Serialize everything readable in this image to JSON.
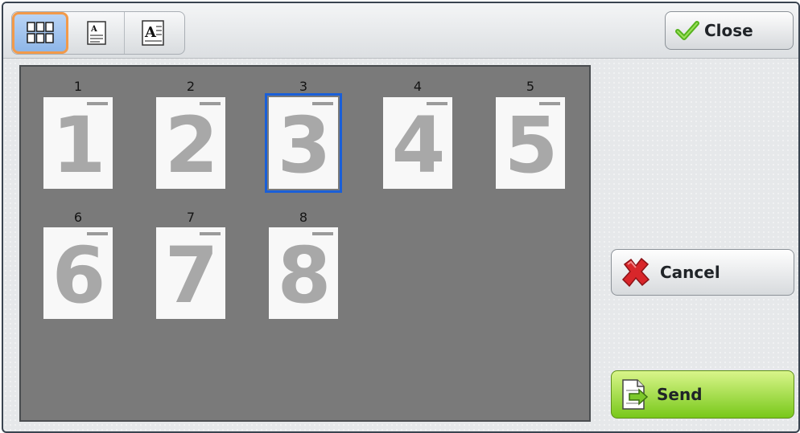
{
  "toolbar": {
    "views": [
      {
        "name": "thumbnail-grid-view",
        "icon": "grid-icon",
        "active": true
      },
      {
        "name": "single-page-view",
        "icon": "page-small-icon",
        "active": false
      },
      {
        "name": "large-page-view",
        "icon": "page-large-icon",
        "active": false
      }
    ],
    "close_label": "Close"
  },
  "preview": {
    "pages": [
      {
        "number": "1",
        "glyph": "1",
        "selected": false
      },
      {
        "number": "2",
        "glyph": "2",
        "selected": false
      },
      {
        "number": "3",
        "glyph": "3",
        "selected": true
      },
      {
        "number": "4",
        "glyph": "4",
        "selected": false
      },
      {
        "number": "5",
        "glyph": "5",
        "selected": false
      },
      {
        "number": "6",
        "glyph": "6",
        "selected": false
      },
      {
        "number": "7",
        "glyph": "7",
        "selected": false
      },
      {
        "number": "8",
        "glyph": "8",
        "selected": false
      }
    ]
  },
  "actions": {
    "cancel_label": "Cancel",
    "send_label": "Send"
  },
  "colors": {
    "accent_selected": "#1a5fd8",
    "active_view_border": "#f29a4a",
    "send_green": "#78c81a",
    "cancel_red": "#d8262a",
    "check_green": "#56b31e"
  }
}
